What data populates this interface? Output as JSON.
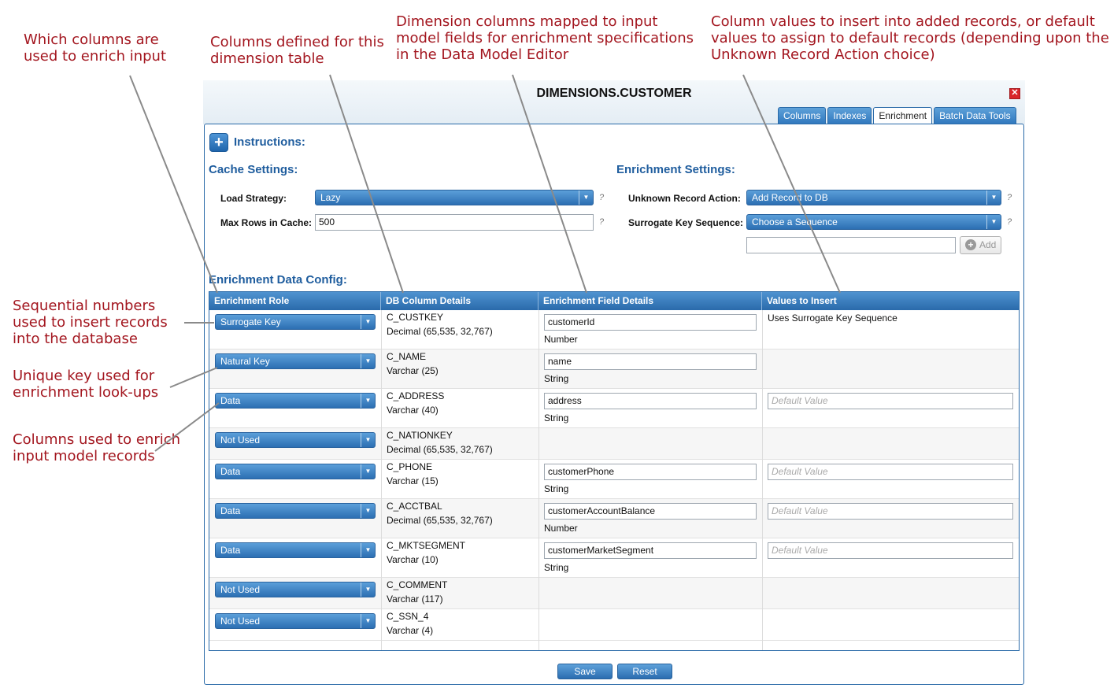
{
  "callouts": {
    "which_columns": "Which columns are used to enrich input",
    "columns_defined": "Columns defined for this dimension table",
    "dimension_columns": "Dimension columns mapped to input model fields for enrichment specifications in the Data Model Editor",
    "column_values": "Column values to insert into added records, or default values to assign to default records (depending upon the Unknown Record Action choice)",
    "sequential_numbers": "Sequential numbers used to insert records into the database",
    "unique_key": "Unique key used for enrichment look-ups",
    "columns_used": "Columns used to enrich input model records"
  },
  "dialog": {
    "title": "DIMENSIONS.CUSTOMER",
    "close_icon": "close-icon",
    "tabs": [
      "Columns",
      "Indexes",
      "Enrichment",
      "Batch Data Tools"
    ],
    "active_tab": "Enrichment"
  },
  "instructions": {
    "label": "Instructions:",
    "icon": "plus-circle-icon"
  },
  "cache_settings": {
    "title": "Cache Settings:",
    "load_strategy_label": "Load Strategy:",
    "load_strategy_value": "Lazy",
    "max_rows_label": "Max Rows in Cache:",
    "max_rows_value": "500",
    "help": "?"
  },
  "enrichment_settings": {
    "title": "Enrichment Settings:",
    "unknown_action_label": "Unknown Record Action:",
    "unknown_action_value": "Add Record to DB",
    "surrogate_seq_label": "Surrogate Key Sequence:",
    "surrogate_seq_value": "Choose a Sequence",
    "new_sequence_value": "",
    "add_label": "Add",
    "help": "?"
  },
  "config": {
    "title": "Enrichment Data Config:",
    "headers": [
      "Enrichment Role",
      "DB Column Details",
      "Enrichment Field Details",
      "Values to Insert"
    ],
    "default_placeholder": "Default Value",
    "rows": [
      {
        "role": "Surrogate Key",
        "column": "C_CUSTKEY",
        "type": "Decimal (65,535, 32,767)",
        "field": "customerId",
        "field_type": "Number",
        "values_text": "Uses Surrogate Key Sequence",
        "has_default": false
      },
      {
        "role": "Natural Key",
        "column": "C_NAME",
        "type": "Varchar (25)",
        "field": "name",
        "field_type": "String",
        "values_text": "",
        "has_default": false
      },
      {
        "role": "Data",
        "column": "C_ADDRESS",
        "type": "Varchar (40)",
        "field": "address",
        "field_type": "String",
        "values_text": "",
        "has_default": true
      },
      {
        "role": "Not Used",
        "column": "C_NATIONKEY",
        "type": "Decimal (65,535, 32,767)",
        "field": "",
        "field_type": "",
        "values_text": "",
        "has_default": false
      },
      {
        "role": "Data",
        "column": "C_PHONE",
        "type": "Varchar (15)",
        "field": "customerPhone",
        "field_type": "String",
        "values_text": "",
        "has_default": true
      },
      {
        "role": "Data",
        "column": "C_ACCTBAL",
        "type": "Decimal (65,535, 32,767)",
        "field": "customerAccountBalance",
        "field_type": "Number",
        "values_text": "",
        "has_default": true
      },
      {
        "role": "Data",
        "column": "C_MKTSEGMENT",
        "type": "Varchar (10)",
        "field": "customerMarketSegment",
        "field_type": "String",
        "values_text": "",
        "has_default": true
      },
      {
        "role": "Not Used",
        "column": "C_COMMENT",
        "type": "Varchar (117)",
        "field": "",
        "field_type": "",
        "values_text": "",
        "has_default": false
      },
      {
        "role": "Not Used",
        "column": "C_SSN_4",
        "type": "Varchar (4)",
        "field": "",
        "field_type": "",
        "values_text": "",
        "has_default": false
      }
    ]
  },
  "buttons": {
    "save": "Save",
    "reset": "Reset"
  },
  "colors": {
    "accent": "#2a6aab",
    "callout": "#a3161f",
    "heading": "#1f5d9e"
  }
}
